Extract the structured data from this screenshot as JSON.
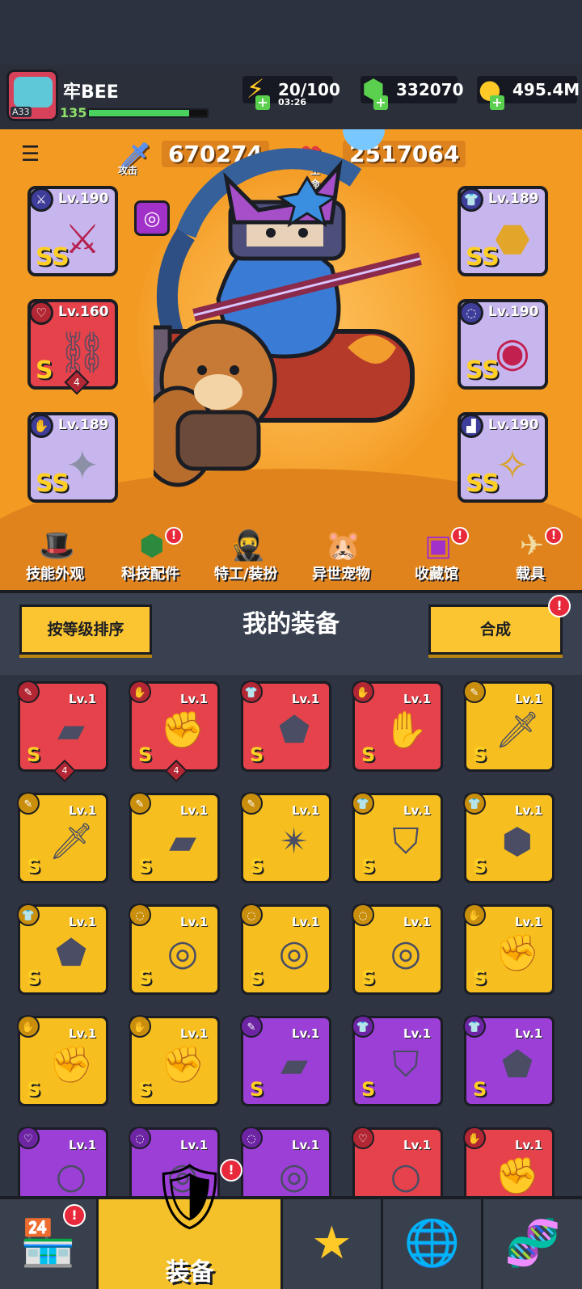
{
  "player": {
    "name": "牢BEE",
    "level": "135",
    "avatar_badge": "A33",
    "xp_fraction": 0.85
  },
  "resources": {
    "energy": {
      "value": "20/100",
      "timer": "03:26"
    },
    "gems": {
      "value": "332070"
    },
    "gold": {
      "value": "495.4M"
    }
  },
  "stats": {
    "attack": {
      "label": "攻击",
      "value": "670274"
    },
    "hp": {
      "label": "生命",
      "value": "2517064"
    }
  },
  "equipped": [
    {
      "level": "Lv.190",
      "grade": "SS",
      "rarity": "purple",
      "slot_icon": "sword-icon"
    },
    {
      "level": "Lv.160",
      "grade": "S",
      "rarity": "red",
      "slot_icon": "necklace-icon",
      "count": "4"
    },
    {
      "level": "Lv.189",
      "grade": "SS",
      "rarity": "purple",
      "slot_icon": "glove-icon"
    },
    {
      "level": "Lv.189",
      "grade": "SS",
      "rarity": "purple",
      "slot_icon": "armor-icon"
    },
    {
      "level": "Lv.190",
      "grade": "SS",
      "rarity": "purple",
      "slot_icon": "belt-icon"
    },
    {
      "level": "Lv.190",
      "grade": "SS",
      "rarity": "purple",
      "slot_icon": "boots-icon"
    }
  ],
  "shortcuts": [
    {
      "label": "技能外观",
      "icon": "hat-icon",
      "badge": false
    },
    {
      "label": "科技配件",
      "icon": "hexagon-chip-icon",
      "badge": true
    },
    {
      "label": "特工/装扮",
      "icon": "agent-icon",
      "badge": false
    },
    {
      "label": "异世宠物",
      "icon": "pet-icon",
      "badge": false
    },
    {
      "label": "收藏馆",
      "icon": "chest-icon",
      "badge": true
    },
    {
      "label": "载具",
      "icon": "vehicle-icon",
      "badge": true
    }
  ],
  "equip_bar": {
    "sort_label": "按等级排序",
    "title": "我的装备",
    "merge_label": "合成",
    "badge": "!"
  },
  "inventory": [
    {
      "level": "Lv.1",
      "grade": "S",
      "rarity": "r",
      "count": "4",
      "icon": "gun-icon"
    },
    {
      "level": "Lv.1",
      "grade": "S",
      "rarity": "r",
      "count": "4",
      "icon": "gauntlet-icon"
    },
    {
      "level": "Lv.1",
      "grade": "S",
      "rarity": "r",
      "icon": "armor-icon"
    },
    {
      "level": "Lv.1",
      "grade": "S",
      "rarity": "r",
      "icon": "glove-icon"
    },
    {
      "level": "Lv.1",
      "grade": "S",
      "rarity": "y",
      "icon": "sword-icon"
    },
    {
      "level": "Lv.1",
      "grade": "S",
      "rarity": "y",
      "icon": "sword-icon"
    },
    {
      "level": "Lv.1",
      "grade": "S",
      "rarity": "y",
      "icon": "gun-icon"
    },
    {
      "level": "Lv.1",
      "grade": "S",
      "rarity": "y",
      "icon": "shuriken-icon"
    },
    {
      "level": "Lv.1",
      "grade": "S",
      "rarity": "y",
      "icon": "helmet-armor-icon"
    },
    {
      "level": "Lv.1",
      "grade": "S",
      "rarity": "y",
      "icon": "dark-armor-icon"
    },
    {
      "level": "Lv.1",
      "grade": "S",
      "rarity": "y",
      "icon": "armor-icon"
    },
    {
      "level": "Lv.1",
      "grade": "S",
      "rarity": "y",
      "icon": "belt-icon"
    },
    {
      "level": "Lv.1",
      "grade": "S",
      "rarity": "y",
      "icon": "belt-icon"
    },
    {
      "level": "Lv.1",
      "grade": "S",
      "rarity": "y",
      "icon": "belt-icon"
    },
    {
      "level": "Lv.1",
      "grade": "S",
      "rarity": "y",
      "icon": "gauntlet-icon"
    },
    {
      "level": "Lv.1",
      "grade": "S",
      "rarity": "y",
      "icon": "gauntlet-icon"
    },
    {
      "level": "Lv.1",
      "grade": "S",
      "rarity": "y",
      "icon": "gauntlet-icon"
    },
    {
      "level": "Lv.1",
      "grade": "S",
      "rarity": "p",
      "icon": "gun-icon"
    },
    {
      "level": "Lv.1",
      "grade": "S",
      "rarity": "p",
      "icon": "helmet-armor-icon"
    },
    {
      "level": "Lv.1",
      "grade": "S",
      "rarity": "p",
      "icon": "armor-icon"
    },
    {
      "level": "Lv.1",
      "grade": "",
      "rarity": "p",
      "icon": "necklace-icon"
    },
    {
      "level": "Lv.1",
      "grade": "",
      "rarity": "p",
      "icon": "belt-icon"
    },
    {
      "level": "Lv.1",
      "grade": "",
      "rarity": "p",
      "icon": "belt-icon"
    },
    {
      "level": "Lv.1",
      "grade": "",
      "rarity": "r",
      "icon": "necklace-icon"
    },
    {
      "level": "Lv.1",
      "grade": "",
      "rarity": "r",
      "icon": "gauntlet-icon"
    }
  ],
  "nav": [
    {
      "label": "",
      "icon": "shop-icon",
      "badge": true
    },
    {
      "label": "装备",
      "icon": "equipment-icon",
      "badge": true,
      "active": true
    },
    {
      "label": "",
      "icon": "swords-star-icon",
      "badge": false
    },
    {
      "label": "",
      "icon": "globe-icon",
      "badge": false
    },
    {
      "label": "",
      "icon": "dna-capsule-icon",
      "badge": false
    }
  ],
  "colors": {
    "stage": "#f39a23",
    "gold": "#f6bf1f",
    "red": "#e6424c",
    "purple": "#9b3fd6",
    "panel": "#394050"
  }
}
